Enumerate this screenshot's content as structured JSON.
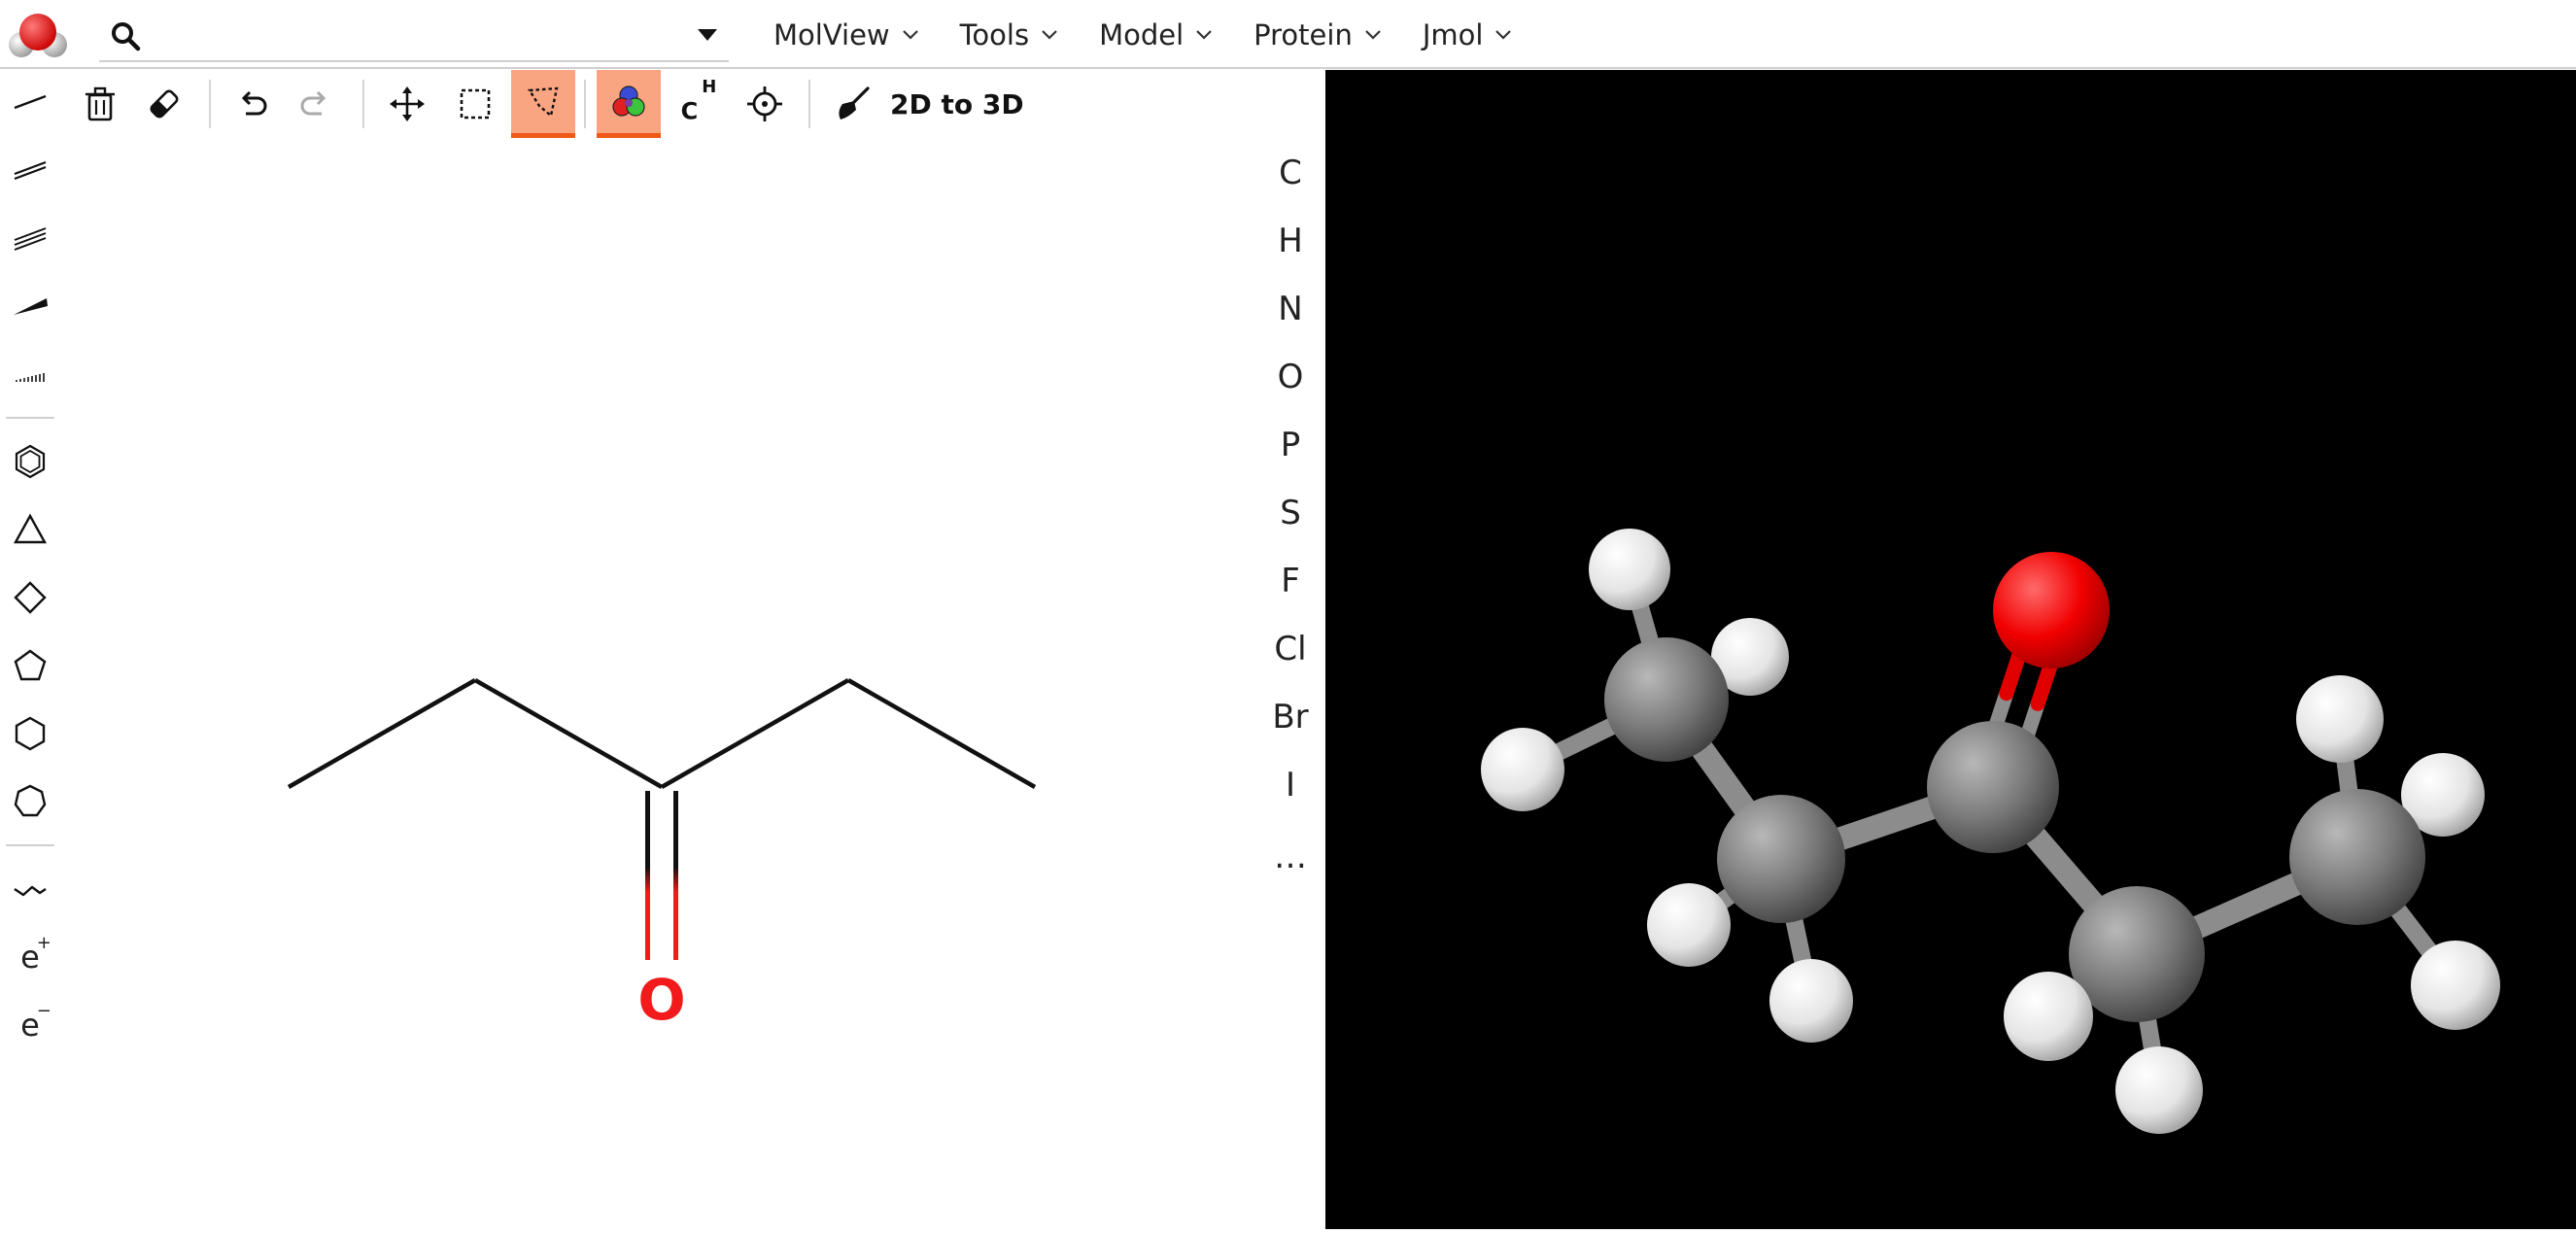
{
  "search": {
    "value": "",
    "placeholder": ""
  },
  "menus": [
    {
      "label": "MolView"
    },
    {
      "label": "Tools"
    },
    {
      "label": "Model"
    },
    {
      "label": "Protein"
    },
    {
      "label": "Jmol"
    }
  ],
  "left_toolbar": {
    "charge_plus": {
      "base": "e",
      "sup": "+"
    },
    "charge_minus": {
      "base": "e",
      "sup": "−"
    }
  },
  "top_toolbar": {
    "chain_label": {
      "base": "C",
      "sup": "H"
    },
    "convert_label": "2D to 3D"
  },
  "elements": [
    "C",
    "H",
    "N",
    "O",
    "P",
    "S",
    "F",
    "Cl",
    "Br",
    "I",
    "…"
  ],
  "sketch": {
    "oxygen_label": "O"
  },
  "colors": {
    "accent": "#ef5a18",
    "active_bg": "#f9a582",
    "oxygen": "#f21a1a",
    "carbon_3d": "#7a7a7a",
    "hydrogen_3d": "#f2f2f2",
    "view_bg": "#000000"
  },
  "icons": [
    "molview-logo-icon",
    "search-icon",
    "chevron-down-icon",
    "single-bond-icon",
    "double-bond-icon",
    "triple-bond-icon",
    "wedge-bond-icon",
    "hash-bond-icon",
    "benzene-icon",
    "triangle-ring-icon",
    "square-ring-icon",
    "pentagon-ring-icon",
    "hexagon-ring-icon",
    "heptagon-ring-icon",
    "chain-icon",
    "trash-icon",
    "eraser-icon",
    "undo-icon",
    "redo-icon",
    "move-icon",
    "rect-select-icon",
    "lasso-select-icon",
    "color-mode-icon",
    "center-icon",
    "broom-icon"
  ]
}
